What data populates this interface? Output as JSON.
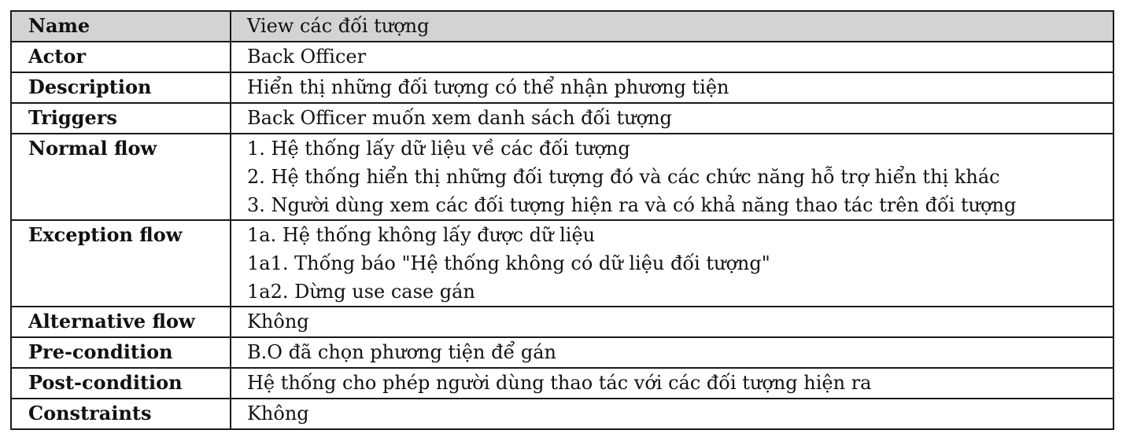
{
  "table": {
    "name": {
      "label": "Name",
      "value": "View các đối tượng"
    },
    "actor": {
      "label": "Actor",
      "value": "Back Officer"
    },
    "description": {
      "label": "Description",
      "value": "Hiển thị những đối tượng có thể nhận phương tiện"
    },
    "triggers": {
      "label": "Triggers",
      "value": "Back Officer muốn xem danh sách đối tượng"
    },
    "normal_flow": {
      "label": "Normal flow",
      "steps": [
        "1. Hệ thống lấy dữ liệu về các đối tượng",
        "2. Hệ thống hiển thị những đối tượng đó và các chức năng hỗ trợ hiển thị khác",
        "3. Người dùng xem các đối tượng hiện ra và có khả năng thao tác trên đối tượng"
      ]
    },
    "exception_flow": {
      "label": "Exception flow",
      "steps": [
        "1a. Hệ thống không lấy được dữ liệu",
        "1a1. Thống báo \"Hệ thống không có dữ liệu đối tượng\"",
        "1a2. Dừng use case gán"
      ]
    },
    "alternative_flow": {
      "label": "Alternative flow",
      "value": "Không"
    },
    "pre_condition": {
      "label": "Pre-condition",
      "value": "B.O đã chọn phương tiện để gán"
    },
    "post_condition": {
      "label": "Post-condition",
      "value": "Hệ thống cho phép người dùng thao tác với các đối tượng hiện ra"
    },
    "constraints": {
      "label": "Constraints",
      "value": "Không"
    }
  }
}
